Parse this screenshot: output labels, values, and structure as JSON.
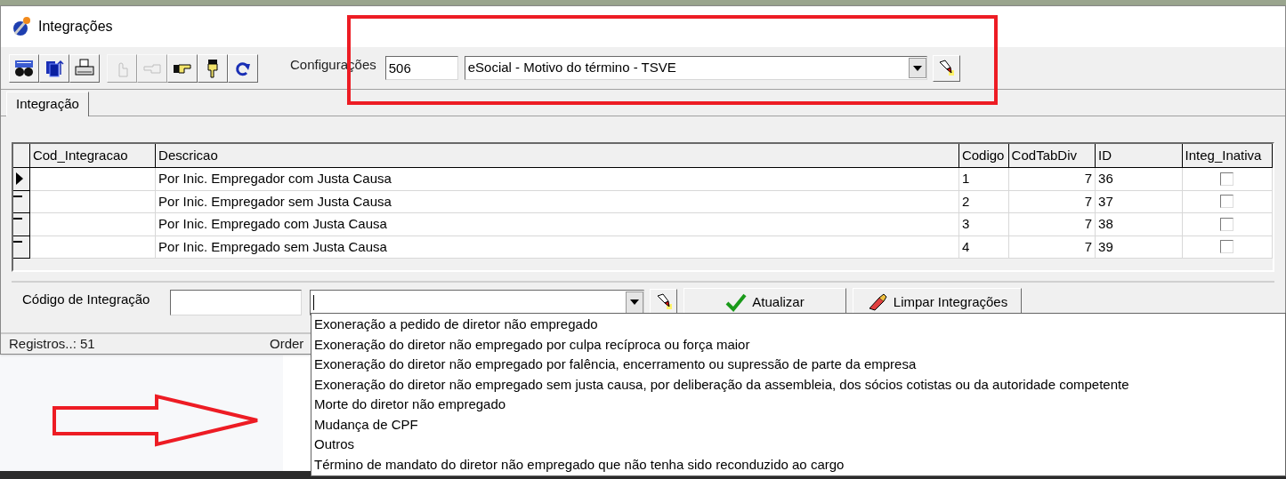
{
  "window": {
    "title": "Integrações"
  },
  "toolbar": {
    "buttons": [
      {
        "kind": "search",
        "disabled": false
      },
      {
        "kind": "export",
        "disabled": false
      },
      {
        "kind": "print",
        "disabled": false
      },
      {
        "kind": "hand_up",
        "disabled": true
      },
      {
        "kind": "hand_left",
        "disabled": true
      },
      {
        "kind": "hand_right",
        "disabled": false
      },
      {
        "kind": "hand_down",
        "disabled": false
      },
      {
        "kind": "redo",
        "disabled": false
      }
    ],
    "config_label": "Configurações",
    "config_code": "506",
    "config_value": "eSocial - Motivo do término - TSVE"
  },
  "tabs": [
    {
      "label": "Integração",
      "selected": true
    }
  ],
  "table": {
    "columns": [
      "Cod_Integracao",
      "Descricao",
      "Codigo",
      "CodTabDiv",
      "ID",
      "Integ_Inativa"
    ],
    "rows": [
      {
        "current": true,
        "cod_integracao": "",
        "descricao": "Por Inic. Empregador com Justa Causa",
        "codigo": "1",
        "codtabdiv": "7",
        "id": "36",
        "integ_inativa": false
      },
      {
        "current": false,
        "cod_integracao": "",
        "descricao": "Por Inic. Empregador sem Justa Causa",
        "codigo": "2",
        "codtabdiv": "7",
        "id": "37",
        "integ_inativa": false
      },
      {
        "current": false,
        "cod_integracao": "",
        "descricao": "Por Inic. Empregado com Justa Causa",
        "codigo": "3",
        "codtabdiv": "7",
        "id": "38",
        "integ_inativa": false
      },
      {
        "current": false,
        "cod_integracao": "",
        "descricao": "Por Inic. Empregado sem Justa Causa",
        "codigo": "4",
        "codtabdiv": "7",
        "id": "39",
        "integ_inativa": false
      }
    ]
  },
  "form": {
    "label": "Código de Integração",
    "buttons": [
      {
        "kind": "update",
        "label": "Atualizar"
      },
      {
        "kind": "clear",
        "label": "Limpar Integrações"
      }
    ]
  },
  "dropdown": {
    "options": [
      {
        "label": "Exoneração a pedido de diretor não empregado",
        "selected": false
      },
      {
        "label": "Exoneração do diretor não empregado por culpa recíproca ou força maior",
        "selected": false
      },
      {
        "label": "Exoneração do diretor não empregado por falência, encerramento ou supressão de parte da empresa",
        "selected": false
      },
      {
        "label": "Exoneração do diretor não empregado sem justa causa, por deliberação da assembleia, dos sócios cotistas ou da autoridade competente",
        "selected": false
      },
      {
        "label": "Morte do diretor não empregado",
        "selected": false
      },
      {
        "label": "Mudança de CPF",
        "selected": false
      },
      {
        "label": "Outros",
        "selected": false
      },
      {
        "label": "Término de mandato do diretor não empregado que não tenha sido reconduzido ao cargo",
        "selected": false
      }
    ]
  },
  "status_bar": {
    "records": "Registros..: 51",
    "order": "Order"
  }
}
